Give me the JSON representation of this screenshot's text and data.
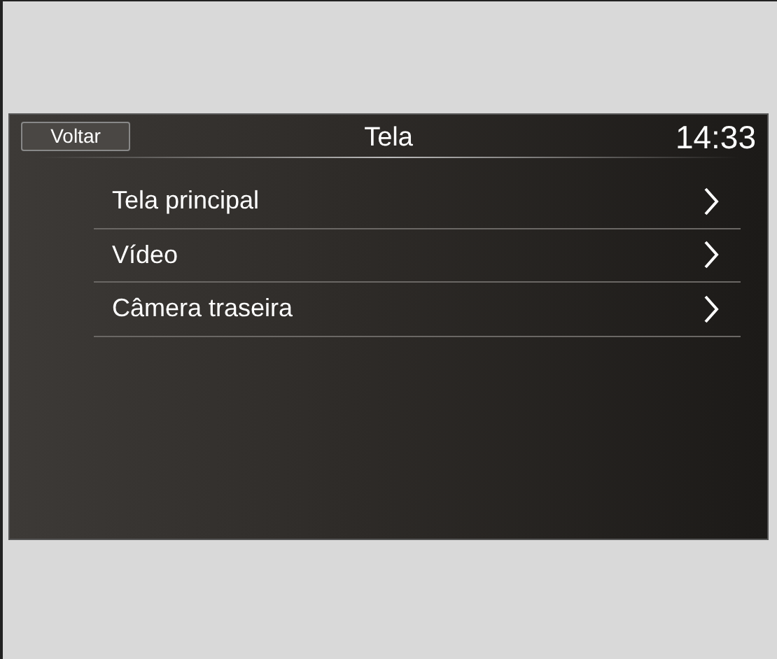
{
  "header": {
    "back_button": "Voltar",
    "title": "Tela",
    "clock": "14:33"
  },
  "menu_items": [
    {
      "label": "Tela principal"
    },
    {
      "label": "Vídeo"
    },
    {
      "label": "Câmera traseira"
    }
  ]
}
